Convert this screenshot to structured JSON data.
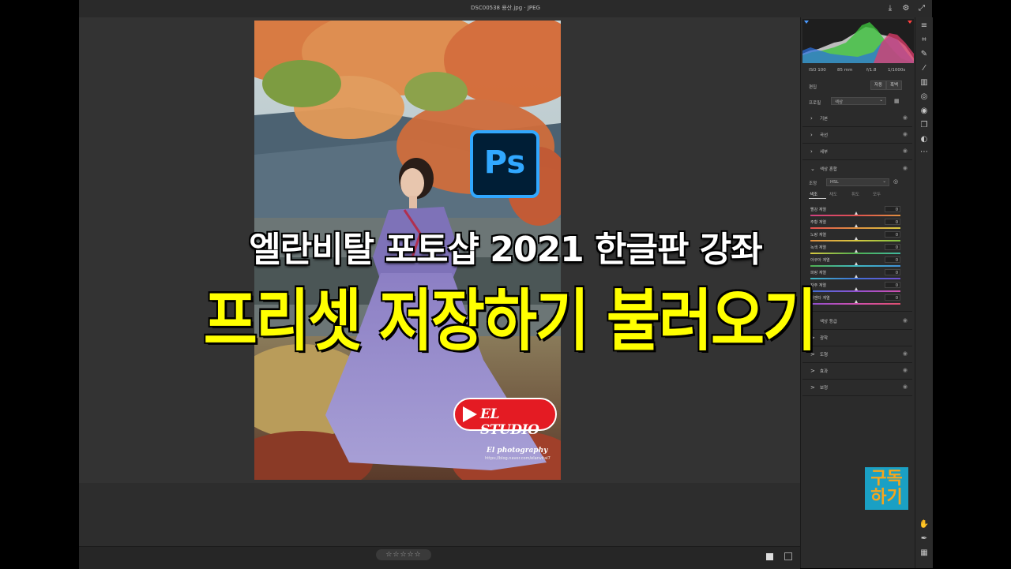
{
  "window": {
    "title": "DSC00538 용산.jpg  ·  JPEG"
  },
  "headline": {
    "line1": "엘란비탈 포토샵 2021 한글판 강좌",
    "line2": "프리셋 저장하기 불러오기"
  },
  "overlays": {
    "ps_logo": "Ps",
    "el_studio": "EL STUDIO",
    "watermark_name": "El photography",
    "watermark_url": "https://blog.naver.com/elanvital7",
    "subscribe_line1": "구독",
    "subscribe_line2": "하기"
  },
  "camera_info": {
    "iso": "ISO 100",
    "focal": "85 mm",
    "aperture": "f/1.8",
    "shutter": "1/1000s"
  },
  "panel": {
    "edit_label": "편집",
    "auto_button": "자동",
    "bw_button": "흑백",
    "profile_label": "프로필",
    "profile_value": "색상",
    "sections_top": [
      {
        "label": "기본"
      },
      {
        "label": "곡선"
      },
      {
        "label": "세부"
      }
    ],
    "color_mixer": {
      "label": "색상 혼합",
      "adjust_label": "조정",
      "adjust_value": "HSL",
      "tabs": [
        "색조",
        "채도",
        "휘도",
        "모두"
      ],
      "sliders": [
        {
          "label": "빨강 계열",
          "value": "0",
          "color": "#e05050"
        },
        {
          "label": "주황 계열",
          "value": "0",
          "color": "#e09040"
        },
        {
          "label": "노랑 계열",
          "value": "0",
          "color": "#d8c840"
        },
        {
          "label": "녹색 계열",
          "value": "0",
          "color": "#50b050"
        },
        {
          "label": "아쿠아 계열",
          "value": "0",
          "color": "#40b8c0"
        },
        {
          "label": "파랑 계열",
          "value": "0",
          "color": "#4070d8"
        },
        {
          "label": "자주 계열",
          "value": "0",
          "color": "#9050d0"
        },
        {
          "label": "마젠타 계열",
          "value": "0",
          "color": "#d050b0"
        }
      ]
    },
    "sections_bottom": [
      {
        "label": "색상 등급",
        "chevron": ""
      },
      {
        "label": "광학",
        "chevron": ">"
      },
      {
        "label": "도형",
        "chevron": ">"
      },
      {
        "label": "효과",
        "chevron": ">"
      },
      {
        "label": "보정",
        "chevron": ">"
      }
    ]
  },
  "rating": {
    "stars": "☆☆☆☆☆"
  },
  "colors": {
    "panel_bg": "#2b2b2b",
    "canvas_bg": "#333333",
    "headline2": "#ffff00",
    "ps_blue": "#31a8ff"
  }
}
